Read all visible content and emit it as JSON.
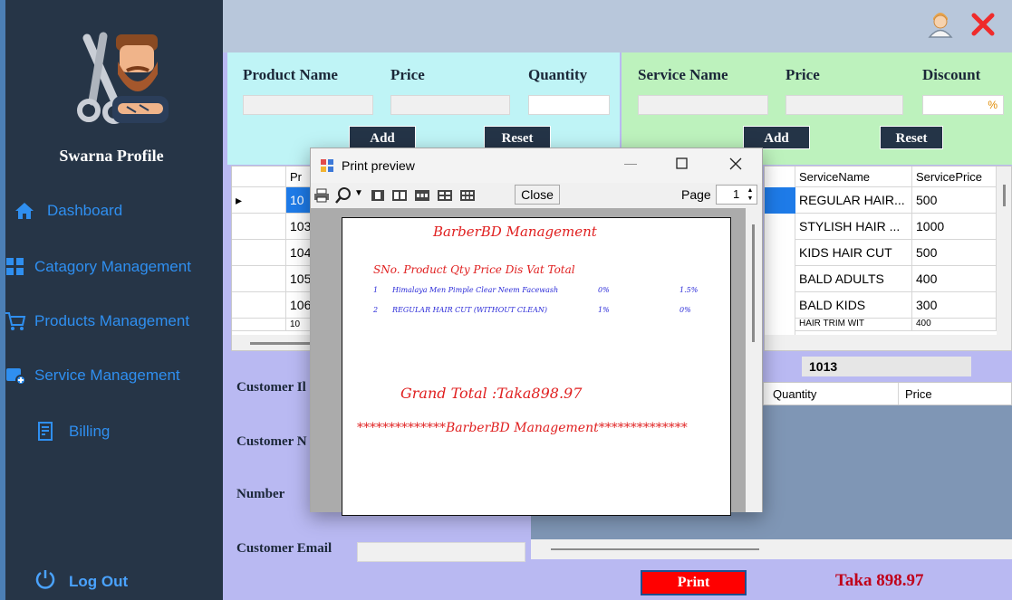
{
  "sidebar": {
    "profile_name": "Swarna Profile",
    "nav": [
      {
        "label": "Dashboard",
        "icon": "home-icon"
      },
      {
        "label": "Catagory Management",
        "icon": "category-icon"
      },
      {
        "label": "Products Management",
        "icon": "cart-icon"
      },
      {
        "label": "Service Management",
        "icon": "service-icon"
      },
      {
        "label": "Billing",
        "icon": "billing-icon"
      }
    ],
    "logout_label": "Log Out"
  },
  "product_panel": {
    "name_label": "Product Name",
    "price_label": "Price",
    "quantity_label": "Quantity",
    "add_label": "Add",
    "reset_label": "Reset"
  },
  "service_panel": {
    "name_label": "Service Name",
    "price_label": "Price",
    "discount_label": "Discount",
    "discount_suffix": "%",
    "add_label": "Add",
    "reset_label": "Reset"
  },
  "product_grid": {
    "header_first": "Pr",
    "rows": [
      "10",
      "103",
      "104",
      "105",
      "106",
      "10"
    ]
  },
  "service_grid": {
    "headers": [
      "ServiceName",
      "ServicePrice"
    ],
    "rows": [
      [
        "REGULAR HAIR...",
        "500"
      ],
      [
        "STYLISH HAIR ...",
        "1000"
      ],
      [
        "KIDS HAIR CUT",
        "500"
      ],
      [
        "BALD ADULTS",
        "400"
      ],
      [
        "BALD KIDS",
        "300"
      ],
      [
        "HAIR TRIM WIT",
        "400"
      ]
    ]
  },
  "bill_id": "1013",
  "bill_grid": {
    "headers": [
      "Quantity",
      "Price"
    ]
  },
  "customer": {
    "id_label": "Customer Il",
    "name_label": "Customer N",
    "number_label": "Number",
    "email_label": "Customer Email"
  },
  "print_label": "Print",
  "total_text": "Taka 898.97",
  "print_preview": {
    "title": "Print preview",
    "close_label": "Close",
    "page_label": "Page",
    "page_value": "1",
    "doc_title": "BarberBD Management",
    "columns_line": "SNo. Product Qty Price Dis Vat Total",
    "items": [
      {
        "sno": "1",
        "text": "Himalaya Men Pimple Clear Neem Facewash",
        "dis": "0%",
        "vat": "1.5%"
      },
      {
        "sno": "2",
        "text": "REGULAR HAIR CUT (WITHOUT CLEAN)",
        "dis": "1%",
        "vat": "0%"
      }
    ],
    "grand_total": "Grand Total :Taka898.97",
    "footer": "**************BarberBD Management**************"
  },
  "colors": {
    "sidebar": "#263547",
    "accent_blue": "#2f8ff0",
    "print_red": "#ff0000",
    "total_red": "#c0001a"
  }
}
